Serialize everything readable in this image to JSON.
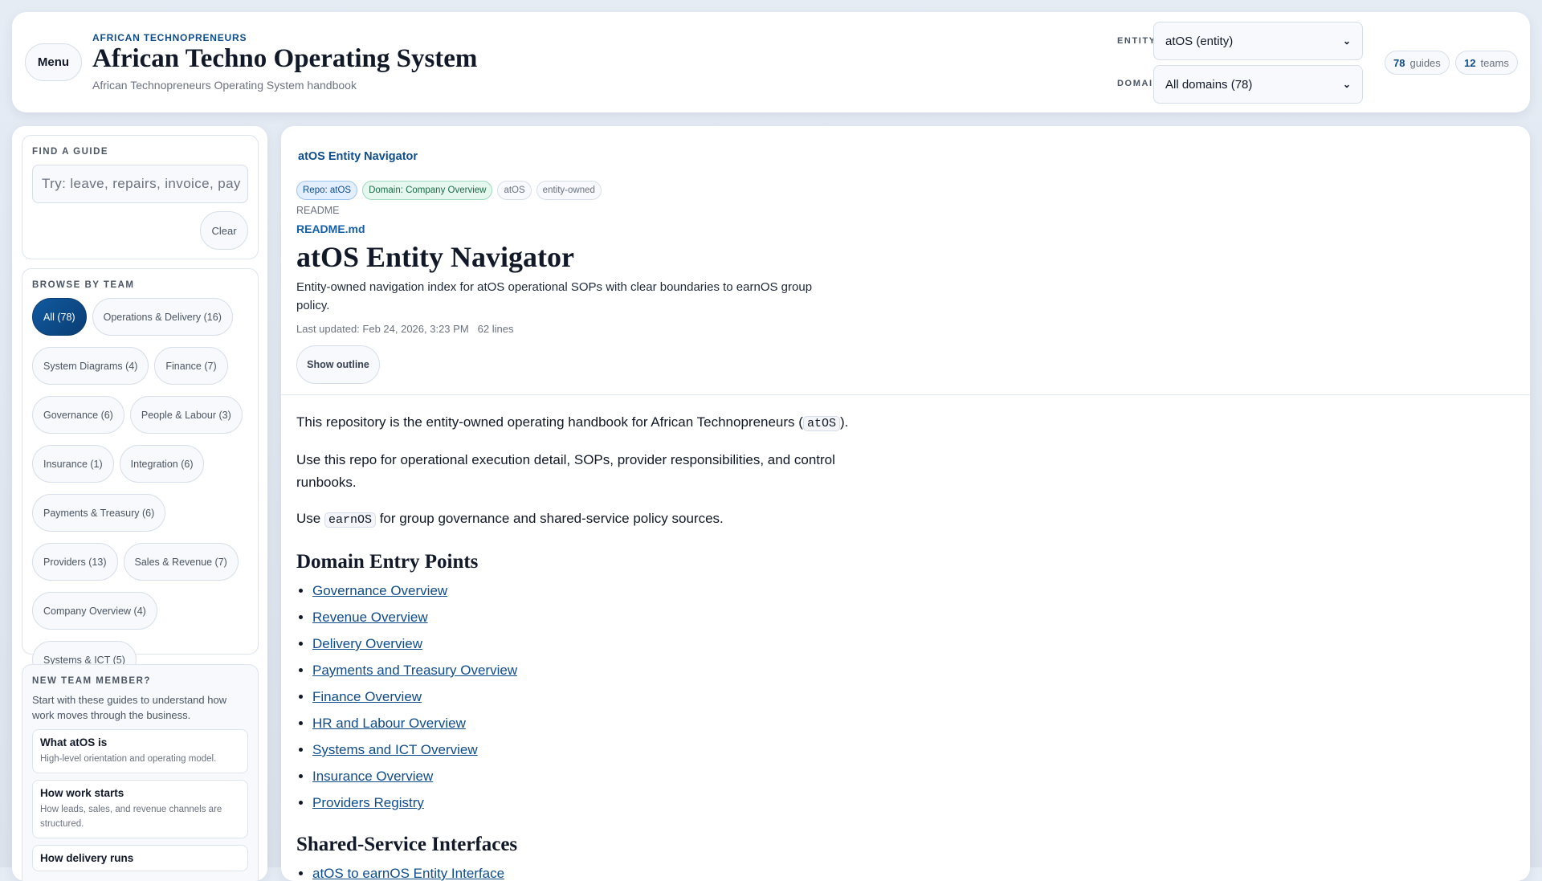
{
  "header": {
    "menu_label": "Menu",
    "eyebrow": "AFRICAN TECHNOPRENEURS",
    "title": "African Techno Operating System",
    "subtitle": "African Technopreneurs Operating System handbook",
    "entity_label": "ENTITY",
    "entity_value": "atOS (entity)",
    "domain_label": "DOMAIN",
    "domain_value": "All domains (78)",
    "stats": [
      {
        "num": "78",
        "label": "guides"
      },
      {
        "num": "12",
        "label": "teams"
      }
    ]
  },
  "sidebar": {
    "find": {
      "title": "FIND A GUIDE",
      "placeholder": "Try: leave, repairs, invoice, pay",
      "clear_label": "Clear"
    },
    "browse": {
      "title": "BROWSE BY TEAM",
      "teams": [
        "All (78)",
        "Operations & Delivery (16)",
        "System Diagrams (4)",
        "Finance (7)",
        "Governance (6)",
        "People & Labour (3)",
        "Insurance (1)",
        "Integration (6)",
        "Payments & Treasury (6)",
        "Providers (13)",
        "Sales & Revenue (7)",
        "Company Overview (4)",
        "Systems & ICT (5)"
      ]
    },
    "new_member": {
      "title": "NEW TEAM MEMBER?",
      "description": "Start with these guides to understand how work moves through the business.",
      "guides": [
        {
          "title": "What atOS is",
          "desc": "High-level orientation and operating model."
        },
        {
          "title": "How work starts",
          "desc": "How leads, sales, and revenue channels are structured."
        },
        {
          "title": "How delivery runs",
          "desc": ""
        }
      ]
    }
  },
  "main": {
    "breadcrumb": "atOS Entity Navigator",
    "chips": [
      "Repo: atOS",
      "Domain: Company Overview",
      "atOS",
      "entity-owned"
    ],
    "kind": "README",
    "file": "README.md",
    "title": "atOS Entity Navigator",
    "description": "Entity-owned navigation index for atOS operational SOPs with clear boundaries to earnOS group policy.",
    "updated": "Last updated: Feb 24, 2026, 3:23 PM",
    "lines": "62 lines",
    "outline_label": "Show outline",
    "body": {
      "p1_a": "This repository is the entity-owned operating handbook for African Technopreneurs (",
      "p1_code": "atOS",
      "p1_b": ").",
      "p2": "Use this repo for operational execution detail, SOPs, provider responsibilities, and control runbooks.",
      "p3_a": "Use ",
      "p3_code": "earnOS",
      "p3_b": " for group governance and shared-service policy sources.",
      "h2_1": "Domain Entry Points",
      "links": [
        "Governance Overview",
        "Revenue Overview",
        "Delivery Overview",
        "Payments and Treasury Overview",
        "Finance Overview",
        "HR and Labour Overview",
        "Systems and ICT Overview",
        "Insurance Overview",
        "Providers Registry"
      ],
      "h2_2": "Shared-Service Interfaces",
      "links2": [
        "atOS to earnOS Entity Interface"
      ]
    }
  }
}
